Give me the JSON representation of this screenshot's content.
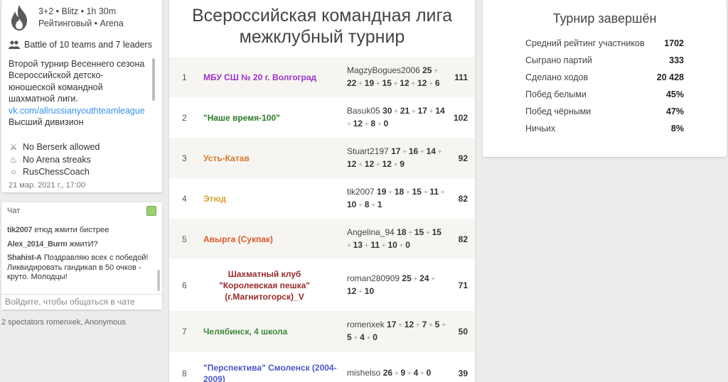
{
  "info": {
    "game_type": "3+2 • Blitz • 1h 30m",
    "mode": "Рейтинговый • Arena",
    "leaders_line": "Battle of 10 teams and 7 leaders",
    "description": "Второй турнир Весеннего сезона Всероссийской детско-юношеской командной шахматной лиги.",
    "link": "vk.com/allrussianyouthteamleague",
    "description_more": "Высший дивизион",
    "rules": [
      {
        "icon": "berserk-icon",
        "text": "No Berserk allowed"
      },
      {
        "icon": "streak-flame-icon",
        "text": "No Arena streaks"
      },
      {
        "icon": "circle-icon",
        "text": "RusChessCoach"
      }
    ],
    "date": "21 мар. 2021 г., 17:00"
  },
  "chat": {
    "title": "Чат",
    "messages": [
      {
        "user": "tik2007",
        "text": "етюд жмити бистрее"
      },
      {
        "user": "Alex_2014_Burm",
        "text": "жмитИ?"
      },
      {
        "user": "Shahist-A",
        "text": "Поздравляю всех с победой! Ликвидировать гандикап в 50 очков - круто. Молодцы!"
      }
    ],
    "input_placeholder": "Войдите, чтобы общаться в чате"
  },
  "spectators": "2 spectators romenxek, Anonymous",
  "standings": {
    "title_line1": "Всероссийская командная лига",
    "title_line2": "межклубный турнир",
    "rows": [
      {
        "rank": "1",
        "team": "МБУ СШ № 20 г. Волгоград",
        "color": "#9c34c7",
        "player": "MagzyBogues2006",
        "scores": [
          "25",
          "22",
          "19",
          "15",
          "12",
          "12",
          "6"
        ],
        "total": "111"
      },
      {
        "rank": "2",
        "team": "\"Наше время-100\"",
        "color": "#2d7a2a",
        "player": "Basuk05",
        "scores": [
          "30",
          "21",
          "17",
          "14",
          "12",
          "8",
          "0"
        ],
        "total": "102"
      },
      {
        "rank": "3",
        "team": "Усть-Катав",
        "color": "#d4792b",
        "player": "Stuart2197",
        "scores": [
          "17",
          "16",
          "14",
          "12",
          "12",
          "12",
          "9"
        ],
        "total": "92"
      },
      {
        "rank": "4",
        "team": "Этюд",
        "color": "#d8a12c",
        "player": "tik2007",
        "scores": [
          "19",
          "18",
          "15",
          "11",
          "10",
          "8",
          "1"
        ],
        "total": "82"
      },
      {
        "rank": "5",
        "team": "Авырга (Сукпак)",
        "color": "#db5a2a",
        "player": "Angelina_94",
        "scores": [
          "18",
          "15",
          "15",
          "13",
          "11",
          "10",
          "0"
        ],
        "total": "82"
      },
      {
        "rank": "6",
        "team": "Шахматный клуб \"Королевская пешка\" (г.Магнитогорск)_V",
        "color": "#962b2b",
        "player": "roman280909",
        "scores": [
          "25",
          "24",
          "12",
          "10"
        ],
        "total": "71"
      },
      {
        "rank": "7",
        "team": "Челябинск, 4 школа",
        "color": "#3c8a3c",
        "player": "romenxek",
        "scores": [
          "17",
          "12",
          "7",
          "5",
          "5",
          "4",
          "0"
        ],
        "total": "50"
      },
      {
        "rank": "8",
        "team": "\"Перспектива\" Смоленск (2004-2009)",
        "color": "#4c56c4",
        "player": "mishelso",
        "scores": [
          "26",
          "9",
          "4",
          "0"
        ],
        "total": "39"
      }
    ]
  },
  "stats": {
    "title": "Турнир завершён",
    "rows": [
      {
        "label": "Средний рейтинг участников",
        "value": "1702"
      },
      {
        "label": "Сыграно партий",
        "value": "333"
      },
      {
        "label": "Сделано ходов",
        "value": "20 428"
      },
      {
        "label": "Побед белыми",
        "value": "45%"
      },
      {
        "label": "Побед чёрными",
        "value": "47%"
      },
      {
        "label": "Ничьих",
        "value": "8%"
      }
    ]
  }
}
